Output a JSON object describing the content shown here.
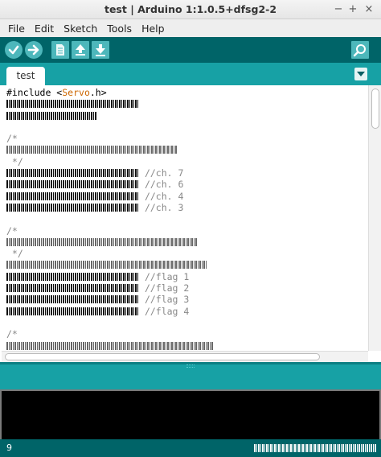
{
  "window": {
    "title": "test | Arduino 1:1.0.5+dfsg2-2",
    "minimize": "−",
    "maximize": "+",
    "close": "×"
  },
  "menu": {
    "file": "File",
    "edit": "Edit",
    "sketch": "Sketch",
    "tools": "Tools",
    "help": "Help"
  },
  "toolbar": {
    "icons": [
      "verify-icon",
      "upload-icon",
      "new-icon",
      "open-icon",
      "save-icon",
      "serial-monitor-icon"
    ]
  },
  "tabs": [
    {
      "label": "test"
    }
  ],
  "editor": {
    "include_prefix": "#include <",
    "include_lib": "Servo",
    "include_suffix": ".h>",
    "comment_open": "/*",
    "comment_close": " */",
    "ch_comments": [
      "//ch. 7",
      "//ch. 6",
      "//ch. 4",
      "//ch. 3"
    ],
    "flag_comments": [
      "//flag 1",
      "//flag 2",
      "//flag 3",
      "//flag 4"
    ]
  },
  "status": {
    "line_number": "9"
  },
  "colors": {
    "toolbar_bg": "#006468",
    "tabbar_bg": "#17a1a5",
    "button_fill": "#4db7bb",
    "keyword": "#cc6600",
    "comment": "#888888"
  }
}
